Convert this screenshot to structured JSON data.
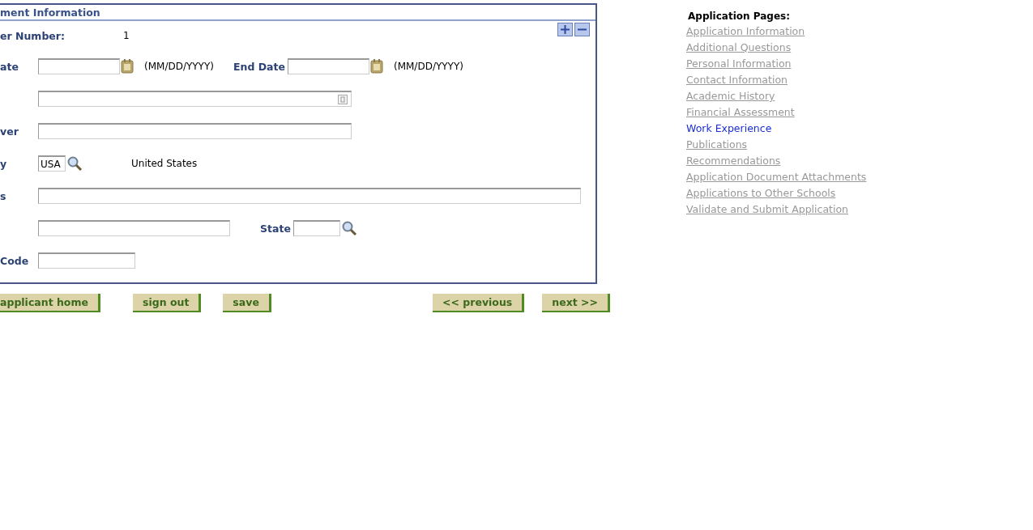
{
  "section": {
    "title": "ment Information"
  },
  "panel_controls": [
    {
      "kind": "expand"
    },
    {
      "kind": "collapse"
    }
  ],
  "rows": [
    {
      "kind": "value",
      "label": "er Number:",
      "value": "1"
    },
    {
      "kind": "date-range",
      "label": "ate",
      "hint": "(MM/DD/YYYY)",
      "end_label": "End Date",
      "end_hint": "(MM/DD/YYYY)"
    },
    {
      "kind": "prompt",
      "label": ""
    },
    {
      "kind": "input-medium",
      "label": "ver"
    },
    {
      "kind": "lookup",
      "label": "y",
      "value": "USA",
      "description": "United States"
    },
    {
      "kind": "input-wide",
      "label": "s"
    },
    {
      "kind": "city-state",
      "label": "",
      "state_label": "State"
    },
    {
      "kind": "input-small",
      "label": "Code"
    }
  ],
  "buttons_left": [
    "applicant home",
    "sign out",
    "save"
  ],
  "buttons_right": [
    "<< previous",
    "next >>"
  ],
  "nav": {
    "title": "Application Pages:",
    "items": [
      {
        "label": "Application Information",
        "selected": false
      },
      {
        "label": "Additional Questions",
        "selected": false
      },
      {
        "label": "Personal Information",
        "selected": false
      },
      {
        "label": "Contact Information",
        "selected": false
      },
      {
        "label": "Academic History",
        "selected": false
      },
      {
        "label": "Financial Assessment",
        "selected": false
      },
      {
        "label": "Work Experience",
        "selected": true
      },
      {
        "label": "Publications",
        "selected": false
      },
      {
        "label": "Recommendations",
        "selected": false
      },
      {
        "label": "Application Document Attachments",
        "selected": false
      },
      {
        "label": "Applications to Other Schools",
        "selected": false
      },
      {
        "label": "Validate and Submit Application",
        "selected": false
      }
    ]
  }
}
